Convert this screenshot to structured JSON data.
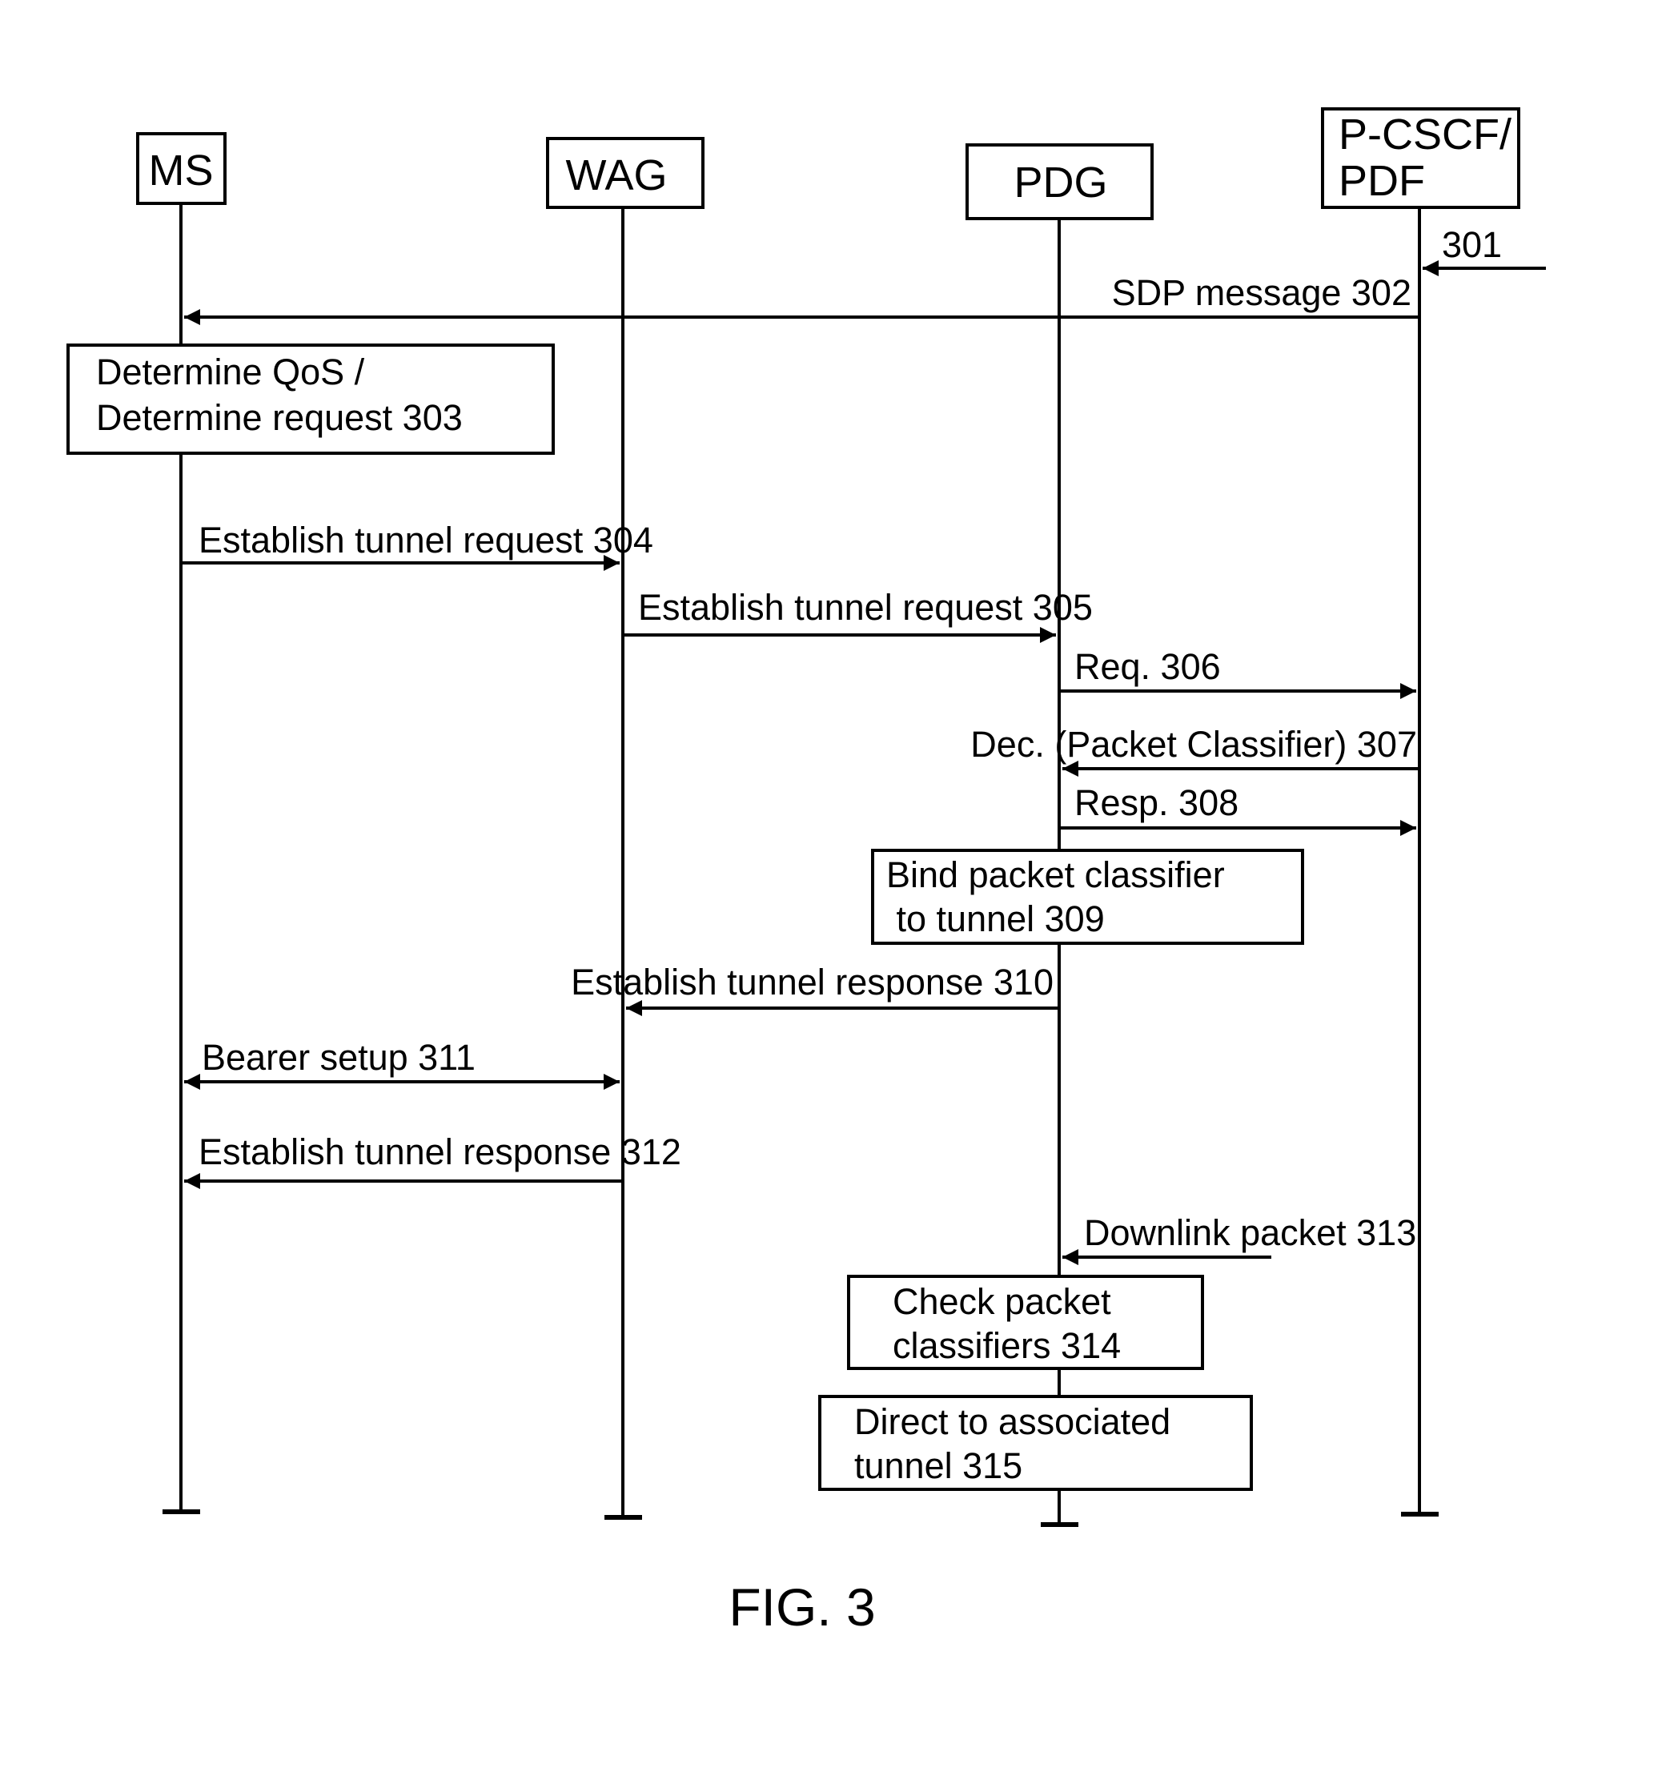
{
  "figure_caption": "FIG. 3",
  "entities": [
    {
      "id": "ms",
      "lines": [
        "MS"
      ]
    },
    {
      "id": "wag",
      "lines": [
        "WAG"
      ]
    },
    {
      "id": "pdg",
      "lines": [
        "PDG"
      ]
    },
    {
      "id": "pcscf",
      "lines": [
        "P-CSCF/",
        "PDF"
      ]
    }
  ],
  "messages": [
    {
      "id": "m301",
      "label": "301",
      "from": "external",
      "to": "pcscf",
      "direction": "left"
    },
    {
      "id": "m302",
      "label": "SDP message 302",
      "from": "pcscf",
      "to": "ms",
      "direction": "left"
    },
    {
      "id": "m304",
      "label": "Establish tunnel request 304",
      "from": "ms",
      "to": "wag",
      "direction": "right"
    },
    {
      "id": "m305",
      "label": "Establish tunnel request 305",
      "from": "wag",
      "to": "pdg",
      "direction": "right"
    },
    {
      "id": "m306",
      "label": "Req. 306",
      "from": "pdg",
      "to": "pcscf",
      "direction": "right"
    },
    {
      "id": "m307",
      "label": "Dec. (Packet Classifier) 307",
      "from": "pcscf",
      "to": "pdg",
      "direction": "left"
    },
    {
      "id": "m308",
      "label": "Resp. 308",
      "from": "pdg",
      "to": "pcscf",
      "direction": "right"
    },
    {
      "id": "m310",
      "label": "Establish tunnel response 310",
      "from": "pdg",
      "to": "wag",
      "direction": "left"
    },
    {
      "id": "m311",
      "label": "Bearer setup 311",
      "from": "ms",
      "to": "wag",
      "direction": "both"
    },
    {
      "id": "m312",
      "label": "Establish tunnel response 312",
      "from": "wag",
      "to": "ms",
      "direction": "left"
    },
    {
      "id": "m313",
      "label": "Downlink packet 313",
      "from": "external",
      "to": "pdg",
      "direction": "left"
    }
  ],
  "process_boxes": [
    {
      "id": "p303",
      "lines": [
        "Determine QoS /",
        "Determine request 303"
      ]
    },
    {
      "id": "p309",
      "lines": [
        "Bind packet classifier",
        " to tunnel 309"
      ]
    },
    {
      "id": "p314",
      "lines": [
        "Check packet",
        "classifiers 314"
      ]
    },
    {
      "id": "p315",
      "lines": [
        "Direct to associated",
        "tunnel 315"
      ]
    }
  ]
}
